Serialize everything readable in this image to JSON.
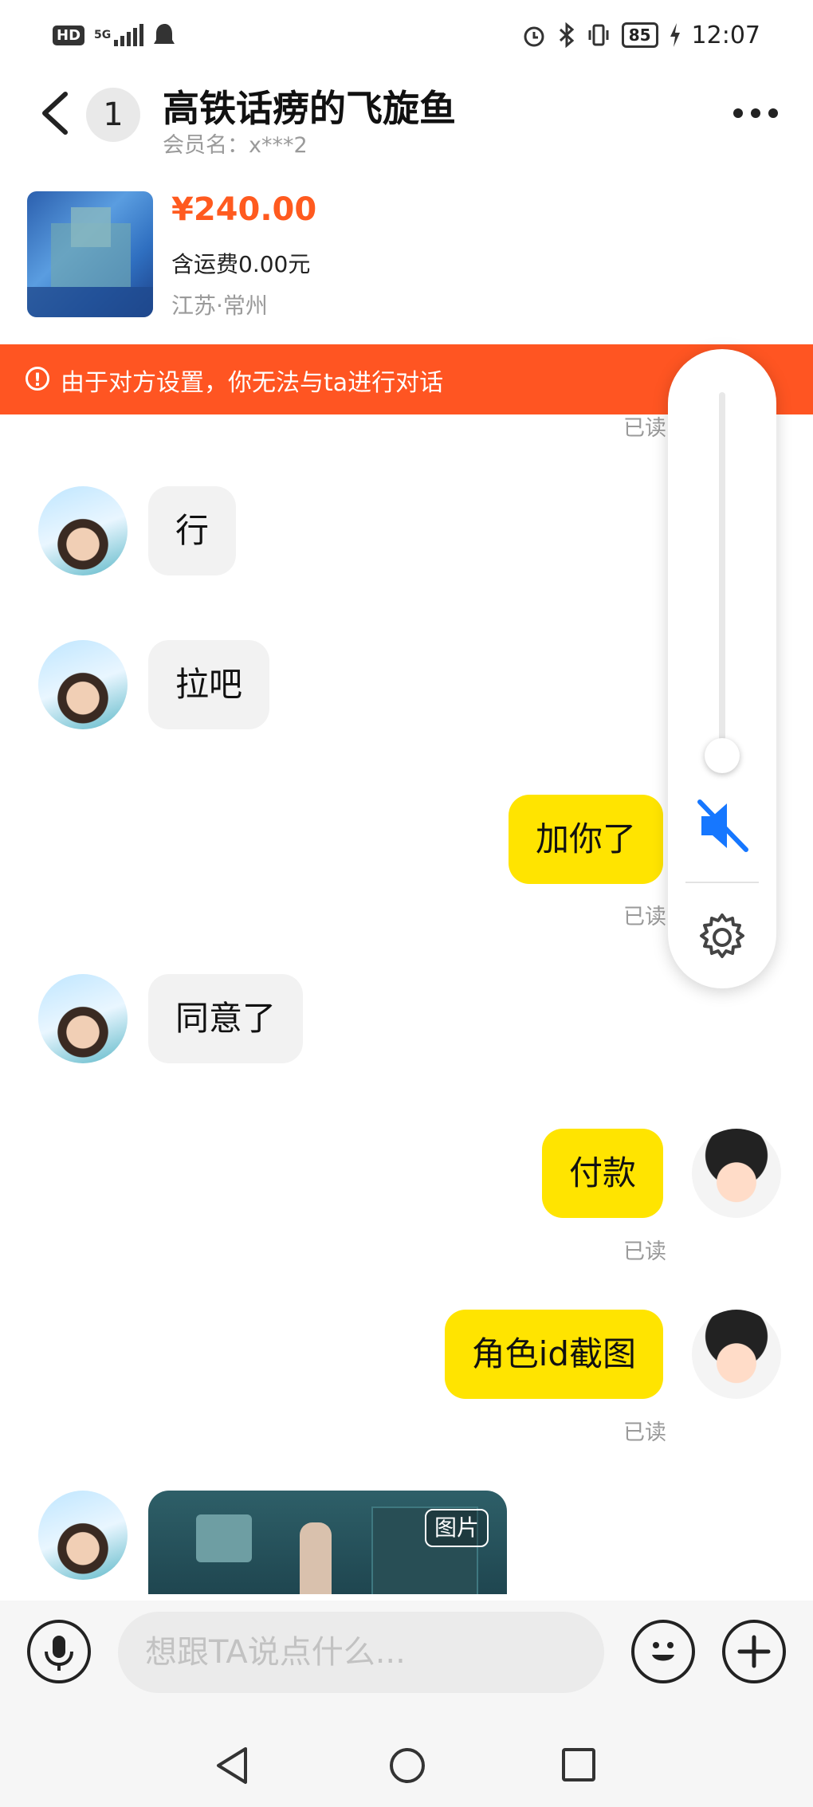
{
  "status_bar": {
    "hd": "HD",
    "network": "5G",
    "battery": "85",
    "time": "12:07"
  },
  "header": {
    "back_icon": "chevron-left-icon",
    "unread_count": "1",
    "title": "高铁话痨的飞旋鱼",
    "subtitle": "会员名：x***2",
    "more_icon": "more-horizontal-icon"
  },
  "product": {
    "price": "¥240.00",
    "shipping": "含运费0.00元",
    "location": "江苏·常州"
  },
  "banner": {
    "icon": "alert-circle-icon",
    "text": "由于对方设置，你无法与ta进行对话",
    "color": "#ff5522"
  },
  "messages": {
    "m0_read": "已读",
    "m1": "行",
    "m2": "拉吧",
    "m3": "加你了",
    "m3_read": "已读",
    "m4": "同意了",
    "m5": "付款",
    "m5_read": "已读",
    "m6": "角色id截图",
    "m6_read": "已读",
    "m7_tag": "图片"
  },
  "volume_panel": {
    "level": 0.0,
    "mute_icon": "speaker-mute-icon",
    "settings_icon": "gear-icon",
    "accent": "#1677ff"
  },
  "input_bar": {
    "mic_icon": "mic-icon",
    "placeholder": "想跟TA说点什么...",
    "emoji_icon": "smile-icon",
    "plus_icon": "plus-icon"
  },
  "colors": {
    "price": "#ff5a1f",
    "my_bubble": "#ffe400",
    "their_bubble": "#f2f2f2"
  }
}
